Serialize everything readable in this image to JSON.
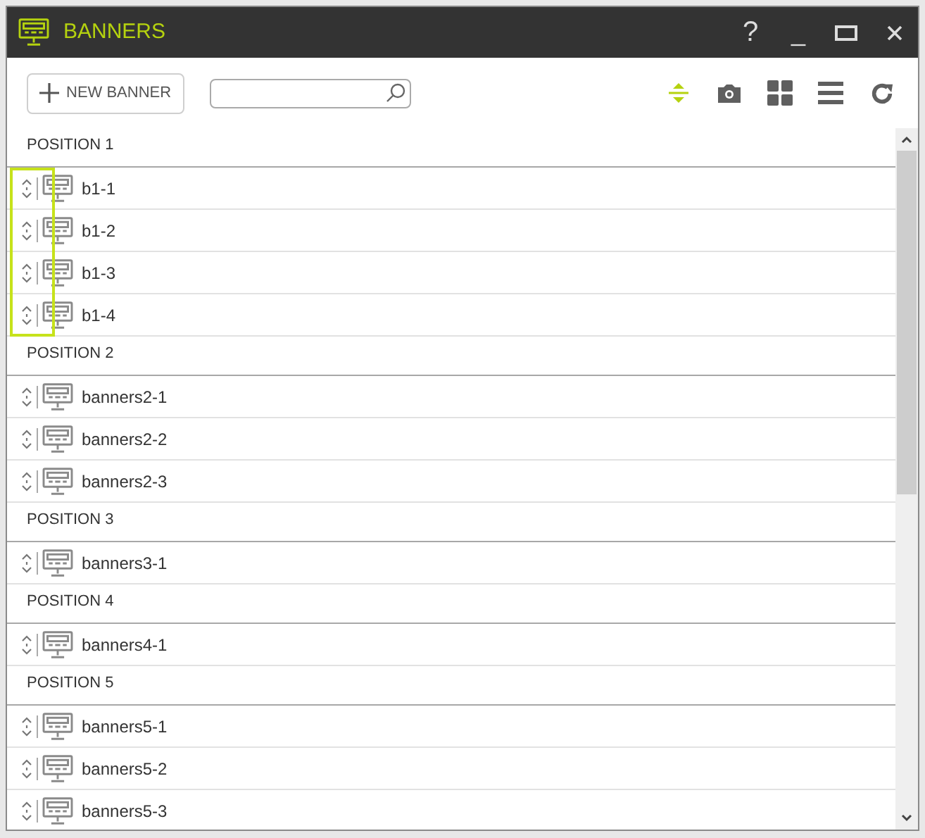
{
  "window": {
    "title": "BANNERS",
    "controls": [
      "?",
      "_"
    ]
  },
  "toolbar": {
    "new_button": "NEW BANNER",
    "tools": [
      {
        "kind": "expand",
        "selected": true
      },
      {
        "kind": "camera",
        "selected": false
      },
      {
        "kind": "grid",
        "selected": false
      },
      {
        "kind": "list",
        "selected": false
      },
      {
        "kind": "refresh",
        "selected": false
      }
    ]
  },
  "groups": [
    {
      "title": "POSITION 1",
      "selected": true,
      "items": [
        "b1-1",
        "b1-2",
        "b1-3",
        "b1-4"
      ]
    },
    {
      "title": "POSITION 2",
      "selected": false,
      "items": [
        "banners2-1",
        "banners2-2",
        "banners2-3"
      ]
    },
    {
      "title": "POSITION 3",
      "selected": false,
      "items": [
        "banners3-1"
      ]
    },
    {
      "title": "POSITION 4",
      "selected": false,
      "items": [
        "banners4-1"
      ]
    },
    {
      "title": "POSITION 5",
      "selected": false,
      "items": [
        "banners5-1",
        "banners5-2",
        "banners5-3"
      ]
    }
  ]
}
